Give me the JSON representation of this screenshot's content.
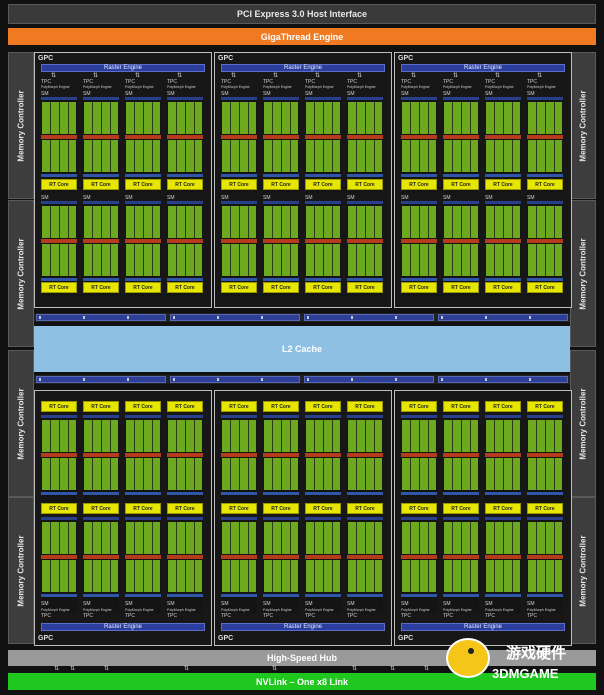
{
  "top": {
    "pcie": "PCI Express 3.0 Host Interface",
    "gigathread": "GigaThread Engine"
  },
  "bottom": {
    "hub": "High-Speed Hub",
    "nvlink": "NVLink – One x8 Link"
  },
  "memory_controller_label": "Memory Controller",
  "l2_cache_label": "L2 Cache",
  "gpc": {
    "label": "GPC",
    "raster_engine": "Raster Engine",
    "tpc_label": "TPC",
    "polymorph_label": "PolyMorph Engine",
    "sm_label": "SM",
    "rt_core_label": "RT Core"
  },
  "watermark": {
    "text_cn": "游戏硬件",
    "text_en": "3DMGAME"
  },
  "colors": {
    "gigathread": "#f07a22",
    "nvlink": "#1fc71f",
    "l2_cache": "#8ec0e4",
    "rt_core": "#e6e600",
    "sm_cores": "#6da91f",
    "raster_engine": "#2b3e9e",
    "hub": "#9a9a9a"
  }
}
